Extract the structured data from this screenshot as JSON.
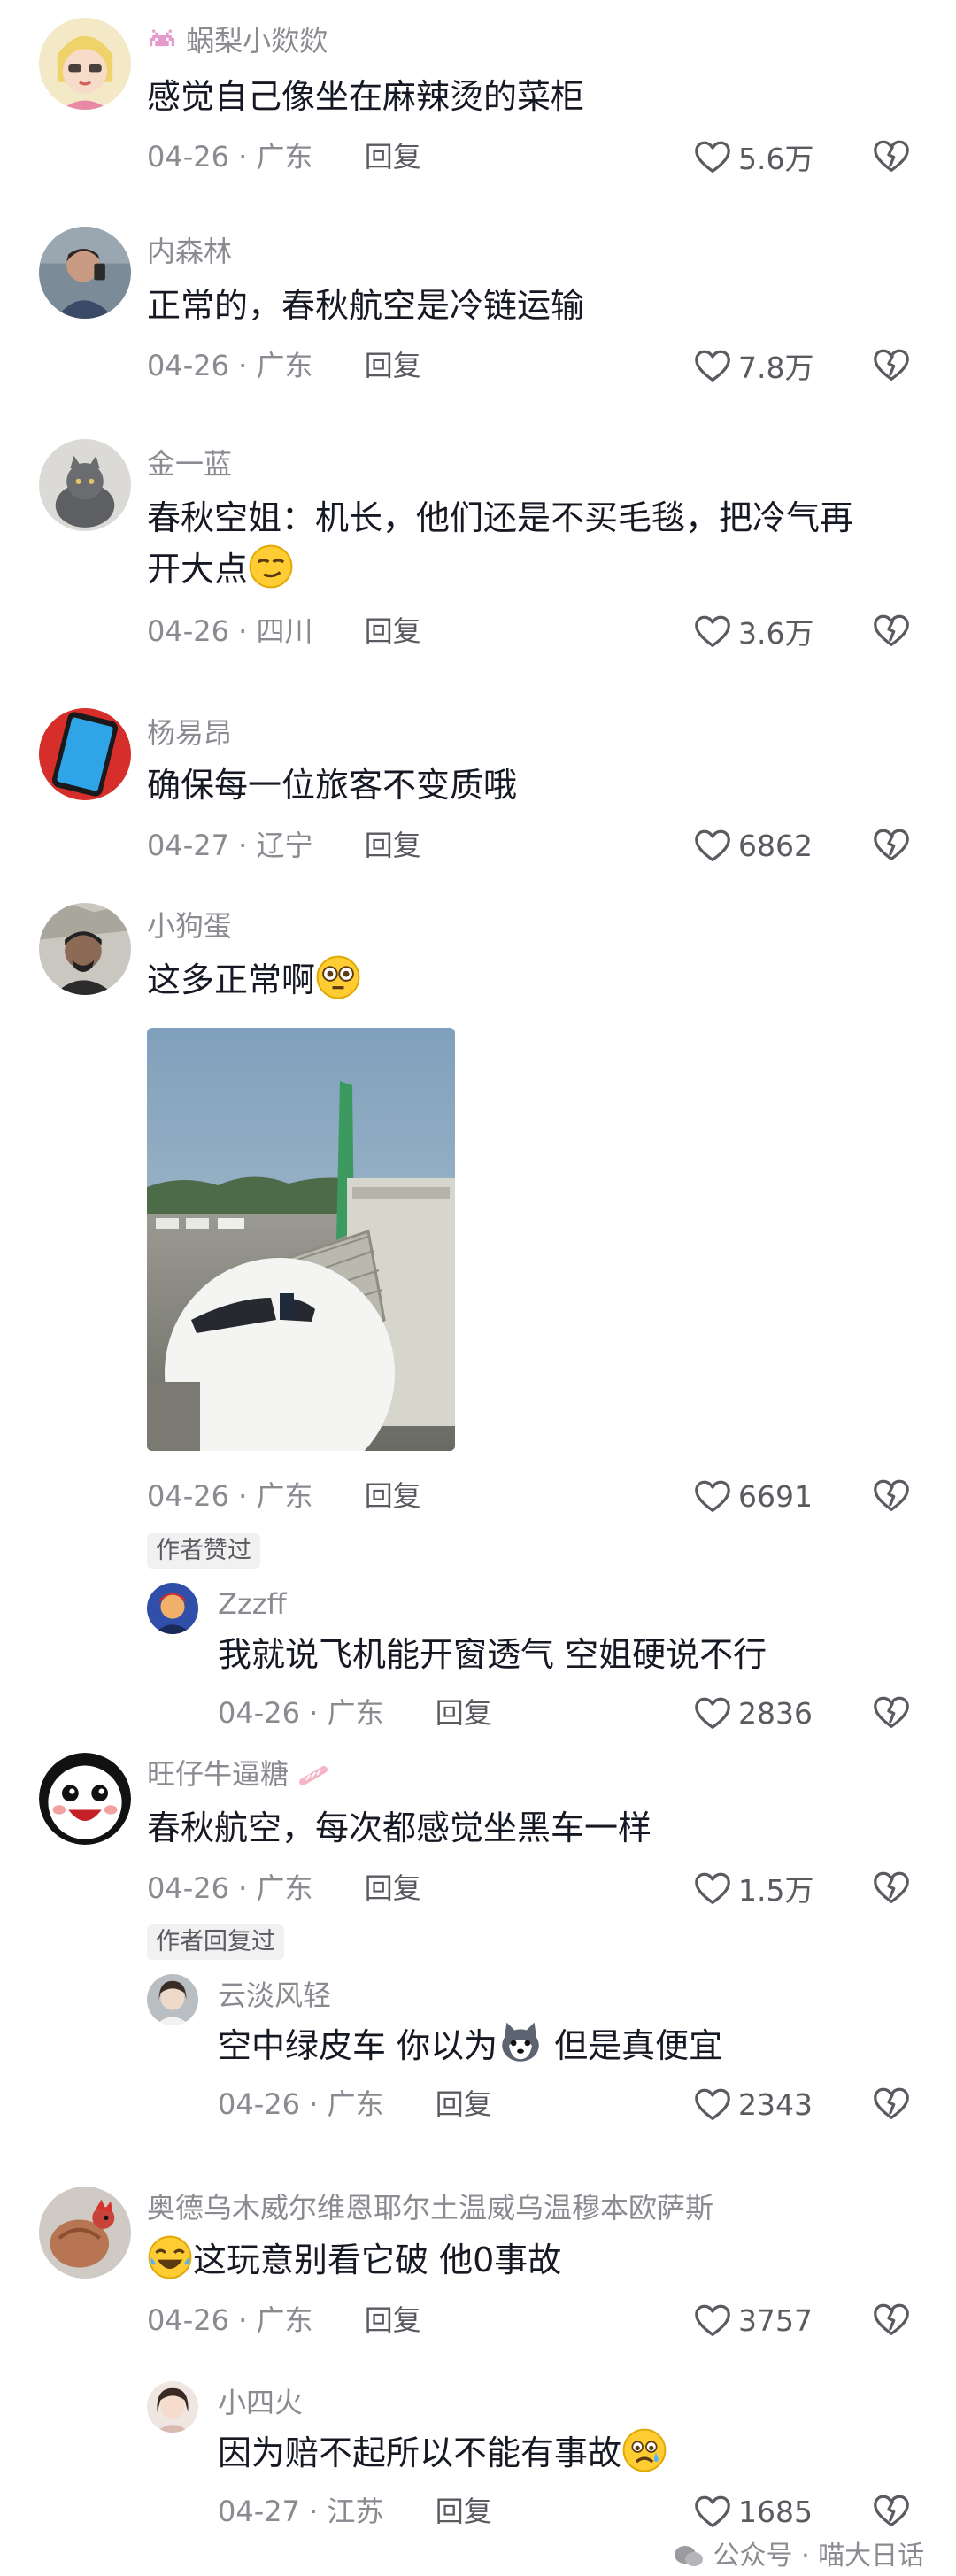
{
  "comments": [
    {
      "username": "蜗梨小欻欻",
      "text": "感觉自己像坐在麻辣烫的菜柜",
      "date": "04-26",
      "location": "广东",
      "reply": "回复",
      "likes": "5.6万"
    },
    {
      "username": "内森林",
      "text": "正常的，春秋航空是冷链运输",
      "date": "04-26",
      "location": "广东",
      "reply": "回复",
      "likes": "7.8万"
    },
    {
      "username": "金一蓝",
      "text_line1": "春秋空姐：机长，他们还是不买毛毯，把冷气再",
      "text_line2": "开大点",
      "date": "04-26",
      "location": "四川",
      "reply": "回复",
      "likes": "3.6万"
    },
    {
      "username": "杨易昂",
      "text": "确保每一位旅客不变质哦",
      "date": "04-27",
      "location": "辽宁",
      "reply": "回复",
      "likes": "6862"
    },
    {
      "username": "小狗蛋",
      "text": "这多正常啊",
      "date": "04-26",
      "location": "广东",
      "reply": "回复",
      "likes": "6691",
      "badge": "作者赞过",
      "sub": {
        "username": "Zzzff",
        "text": "我就说飞机能开窗透气 空姐硬说不行",
        "date": "04-26",
        "location": "广东",
        "reply": "回复",
        "likes": "2836"
      }
    },
    {
      "username": "旺仔牛逼糖",
      "text": "春秋航空，每次都感觉坐黑车一样",
      "date": "04-26",
      "location": "广东",
      "reply": "回复",
      "likes": "1.5万",
      "badge": "作者回复过",
      "sub": {
        "username": "云淡风轻",
        "text_a": "空中绿皮车 你以为",
        "text_b": "但是真便宜",
        "date": "04-26",
        "location": "广东",
        "reply": "回复",
        "likes": "2343"
      }
    },
    {
      "username": "奥德乌木威尔维恩耶尔土温威乌温穆本欧萨斯",
      "text": "这玩意别看它破 他0事故",
      "date": "04-26",
      "location": "广东",
      "reply": "回复",
      "likes": "3757",
      "sub": {
        "username": "小四火",
        "text": "因为赔不起所以不能有事故",
        "date": "04-27",
        "location": "江苏",
        "reply": "回复",
        "likes": "1685"
      }
    }
  ],
  "separator": "·",
  "watermark": "公众号 · 喵大日话",
  "icons": {
    "like": "heart-outline-icon",
    "dislike": "broken-heart-icon"
  },
  "colors": {
    "text": "#161823",
    "meta": "#8a8b91",
    "tag_bg": "#f1f1f2"
  }
}
